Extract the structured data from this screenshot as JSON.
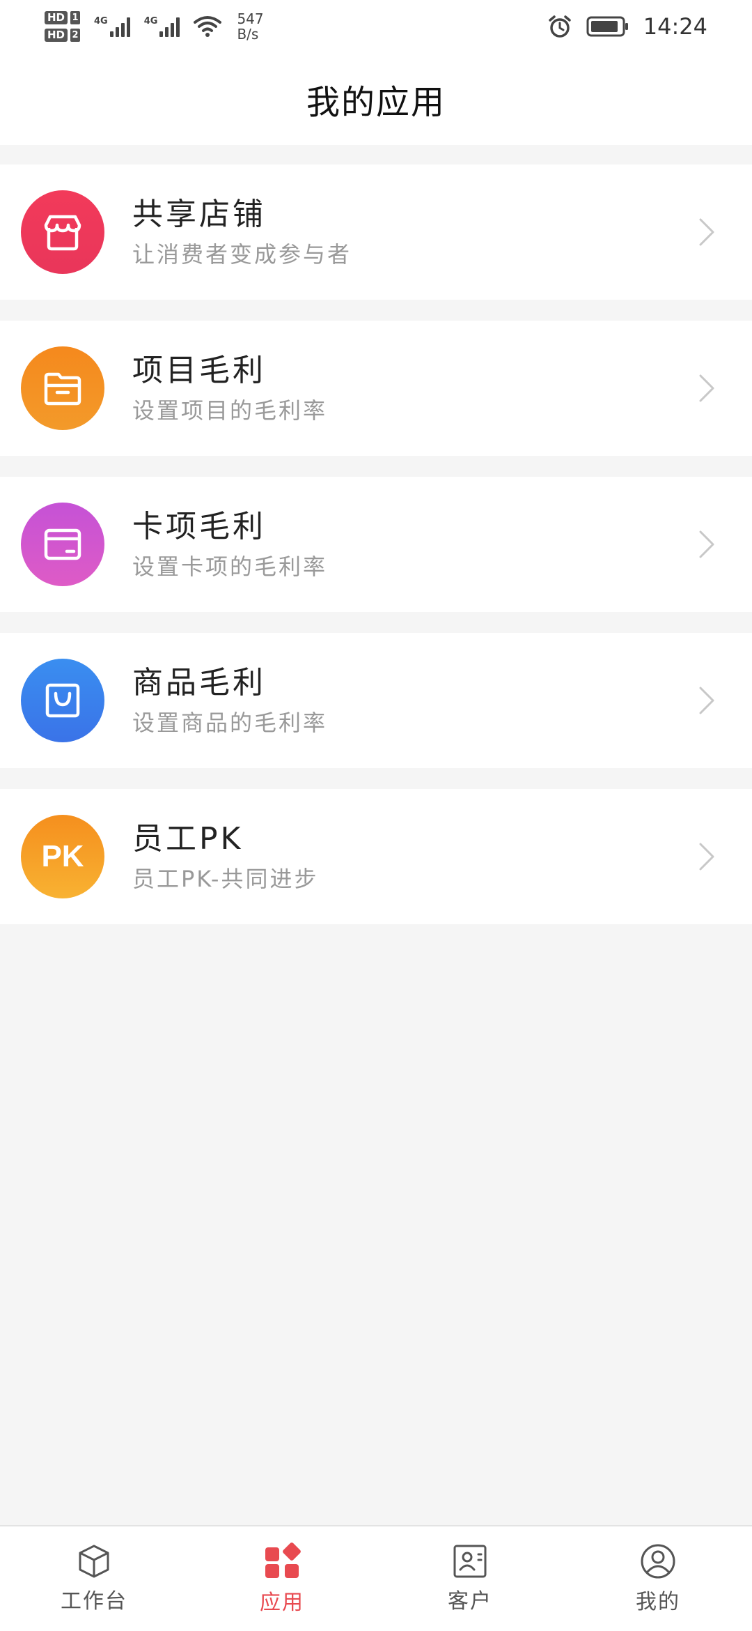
{
  "status_bar": {
    "hd1": "HD",
    "hd1_num": "1",
    "hd2": "HD",
    "hd2_num": "2",
    "net1": "4G",
    "net2": "4G",
    "speed_value": "547",
    "speed_unit": "B/s",
    "time": "14:24"
  },
  "header": {
    "title": "我的应用"
  },
  "apps": [
    {
      "title": "共享店铺",
      "subtitle": "让消费者变成参与者",
      "icon": "store-icon",
      "color": "#ee3a56"
    },
    {
      "title": "项目毛利",
      "subtitle": "设置项目的毛利率",
      "icon": "folder-icon",
      "color": "#f58a1f"
    },
    {
      "title": "卡项毛利",
      "subtitle": "设置卡项的毛利率",
      "icon": "card-icon",
      "color": "#cf55d2"
    },
    {
      "title": "商品毛利",
      "subtitle": "设置商品的毛利率",
      "icon": "shopping-bag-icon",
      "color": "#3a86ee"
    },
    {
      "title": "员工PK",
      "subtitle": "员工PK-共同进步",
      "icon": "pk-icon",
      "icon_text": "PK",
      "color": "#f7a020"
    }
  ],
  "bottom_nav": {
    "items": [
      {
        "label": "工作台",
        "icon": "cube-icon"
      },
      {
        "label": "应用",
        "icon": "apps-grid-icon",
        "active": true
      },
      {
        "label": "客户",
        "icon": "contact-card-icon"
      },
      {
        "label": "我的",
        "icon": "profile-icon"
      }
    ],
    "active_color": "#e84a50"
  }
}
